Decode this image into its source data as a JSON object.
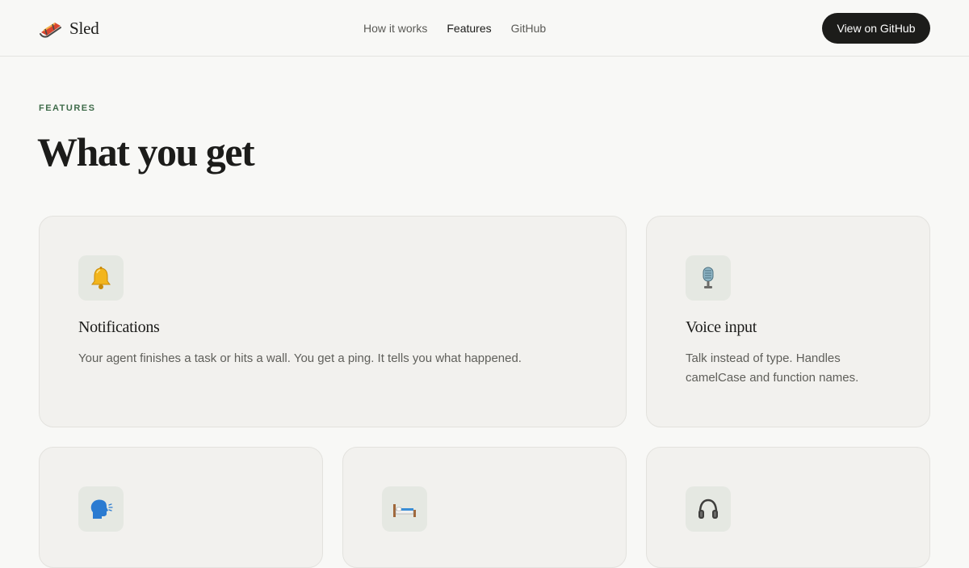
{
  "brand": {
    "name": "Sled",
    "logo_icon": "sled-icon"
  },
  "nav": {
    "items": [
      {
        "label": "How it works",
        "active": false
      },
      {
        "label": "Features",
        "active": true
      },
      {
        "label": "GitHub",
        "active": false
      }
    ],
    "cta_label": "View on GitHub"
  },
  "section": {
    "eyebrow": "FEATURES",
    "title": "What you get"
  },
  "features": [
    {
      "icon": "bell-icon",
      "title": "Notifications",
      "description": "Your agent finishes a task or hits a wall. You get a ping. It tells you what happened."
    },
    {
      "icon": "microphone-icon",
      "title": "Voice input",
      "description": "Talk instead of type. Handles camelCase and function names."
    },
    {
      "icon": "speaking-head-icon",
      "title": "",
      "description": ""
    },
    {
      "icon": "bed-icon",
      "title": "",
      "description": ""
    },
    {
      "icon": "headphones-icon",
      "title": "",
      "description": ""
    }
  ],
  "colors": {
    "background": "#f8f8f6",
    "card_background": "#f2f1ee",
    "icon_tile": "#e5e8e2",
    "accent_green": "#3f6b4a",
    "button_dark": "#1c1c1a"
  }
}
